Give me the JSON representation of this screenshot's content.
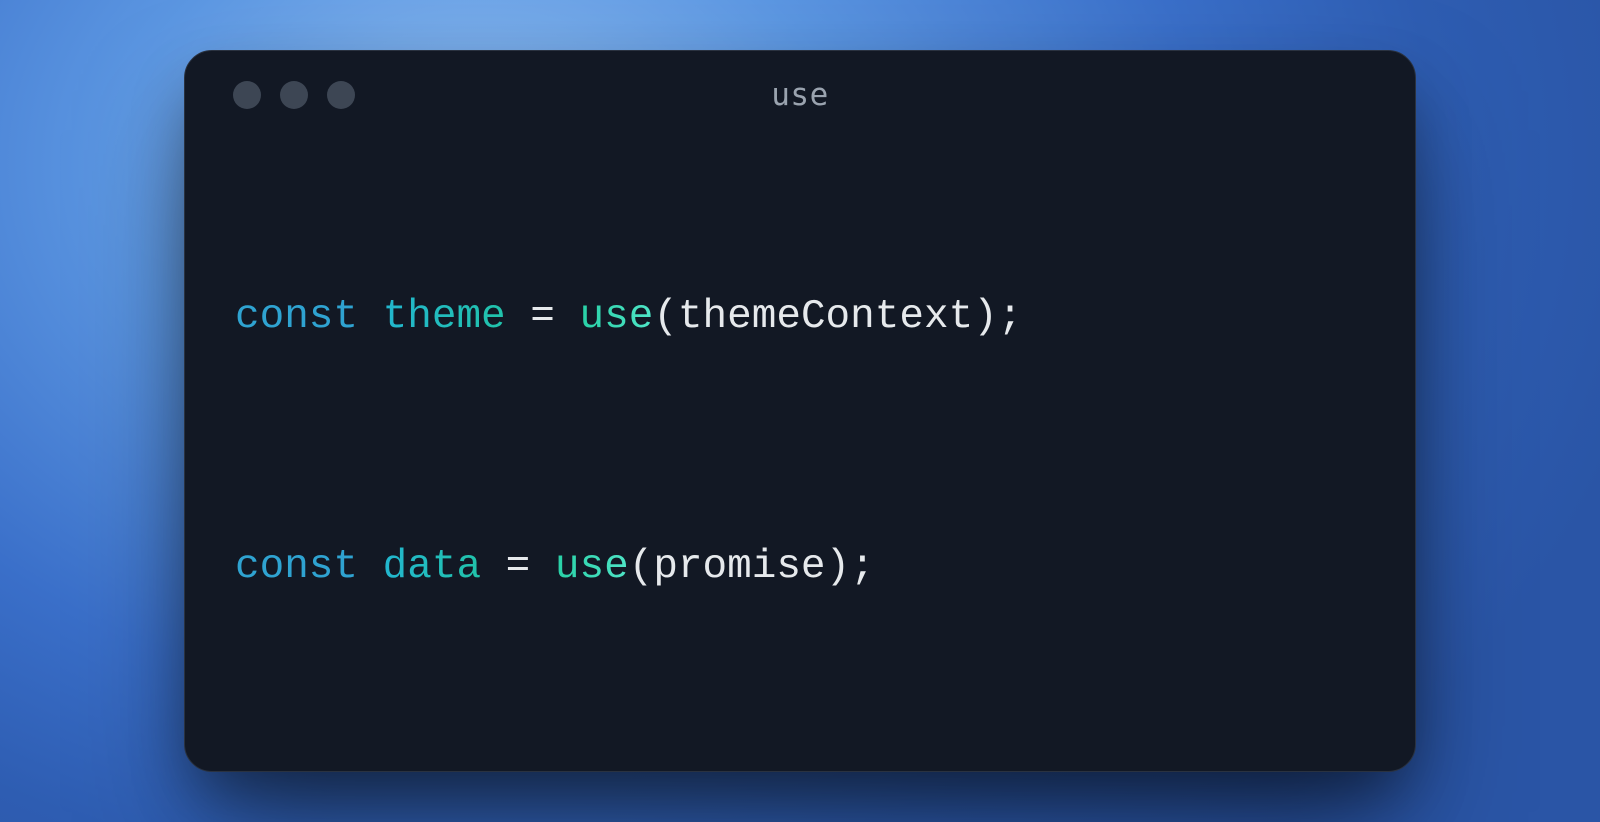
{
  "window": {
    "title": "use"
  },
  "code": {
    "line1": {
      "keyword": "const",
      "variable": "theme",
      "eq": "=",
      "func": "use",
      "open": "(",
      "arg": "themeContext",
      "close": ")",
      "semi": ";"
    },
    "line2": {
      "keyword": "const",
      "variable": "data",
      "eq": "=",
      "func": "use",
      "open": "(",
      "arg": "promise",
      "close": ")",
      "semi": ";"
    }
  }
}
